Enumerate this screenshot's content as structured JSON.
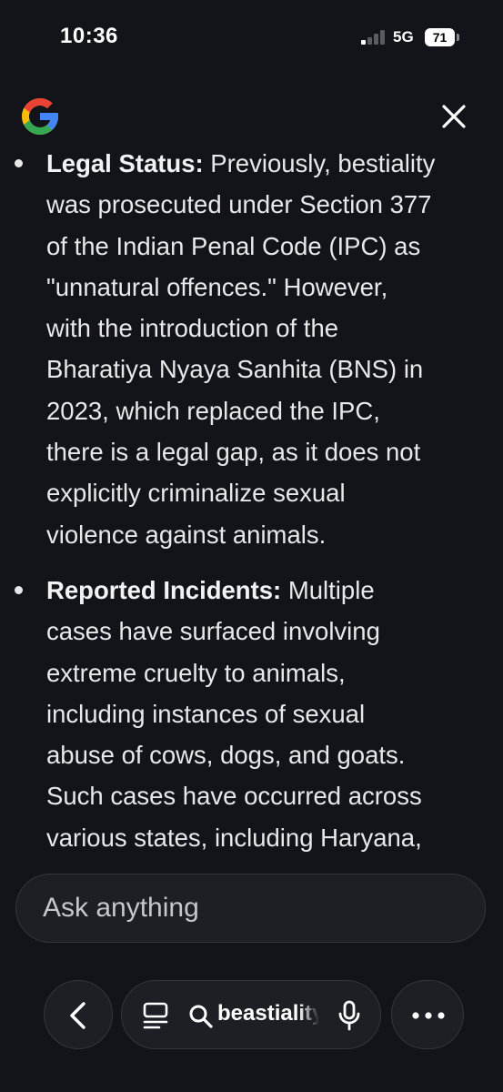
{
  "status_bar": {
    "time": "10:36",
    "network": "5G",
    "battery": "71"
  },
  "colors": {
    "background": "#131419",
    "text": "#e8e8ea",
    "surface": "#1e1f25",
    "google_blue": "#4285F4",
    "google_red": "#EA4335",
    "google_yellow": "#FBBC05",
    "google_green": "#34A853"
  },
  "header": {
    "logo_icon": "google-g-icon",
    "close_icon": "close-icon"
  },
  "content": {
    "items": [
      {
        "lead": "Legal Status:",
        "lines": [
          " Previously, bestiality",
          "was prosecuted under Section 377",
          "of the Indian Penal Code (IPC) as",
          "\"unnatural offences.\" However,",
          "with the introduction of the",
          "Bharatiya Nyaya Sanhita (BNS) in",
          "2023, which replaced the IPC,",
          "there is a legal gap, as it does not",
          "explicitly criminalize sexual",
          "violence against animals."
        ]
      },
      {
        "lead": "Reported Incidents:",
        "lines": [
          " Multiple",
          "cases have surfaced involving",
          "extreme cruelty to animals,",
          "including instances of sexual",
          "abuse of cows, dogs, and goats.",
          "Such cases have occurred across",
          "various states, including Haryana,"
        ]
      }
    ]
  },
  "ask_bar": {
    "placeholder": "Ask anything"
  },
  "bottom_nav": {
    "back_icon": "chevron-left-icon",
    "lens_icon": "text-lines-icon",
    "search_icon": "search-icon",
    "query": "beastiality",
    "mic_icon": "mic-icon",
    "more_icon": "more-horizontal-icon"
  }
}
